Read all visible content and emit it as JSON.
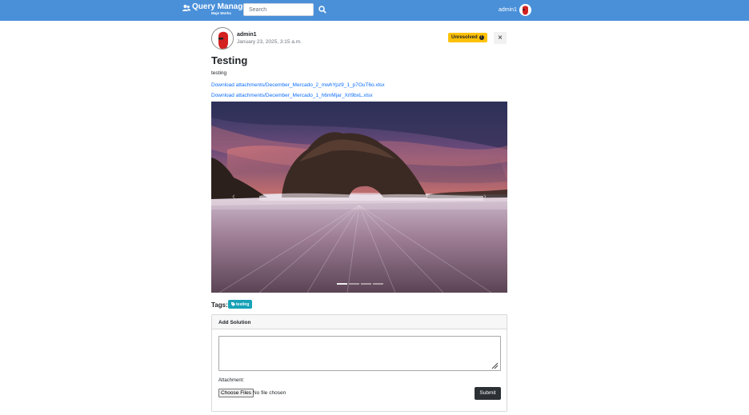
{
  "navbar": {
    "brand_title": "Query Manager",
    "brand_subtitle": "Maje Works",
    "brand_icon": "users-icon",
    "search_placeholder": "Search",
    "search_icon": "search-icon",
    "user_name": "admin1",
    "background_color": "#4a90d9"
  },
  "post": {
    "author": "admin1",
    "date": "January 23, 2025, 3:15 a.m.",
    "status": "Unresolved",
    "status_icon": "exclamation-circle-icon",
    "status_color": "#ffc107",
    "close_label": "×",
    "title": "Testing",
    "body": "testing",
    "attachments": [
      "Download attachments/December_Mercado_2_mwhYpz9_1_p7OuT6o.xlsx",
      "Download attachments/December_Mercado_1_h6mMjar_Xrl9bxL.xlsx"
    ],
    "link_color": "#0d6efd"
  },
  "carousel": {
    "prev_label": "‹",
    "next_label": "›",
    "slide_count": 4,
    "active_index": 0
  },
  "tags": {
    "label": "Tags:",
    "items": [
      "testing"
    ],
    "tag_icon": "tag-icon",
    "tag_color": "#17a2b8"
  },
  "solution": {
    "header": "Add Solution",
    "text_value": "",
    "attachment_label": "Attachment:",
    "choose_files_label": "Choose Files",
    "no_file_text": "No file chosen",
    "submit_label": "Submit"
  }
}
